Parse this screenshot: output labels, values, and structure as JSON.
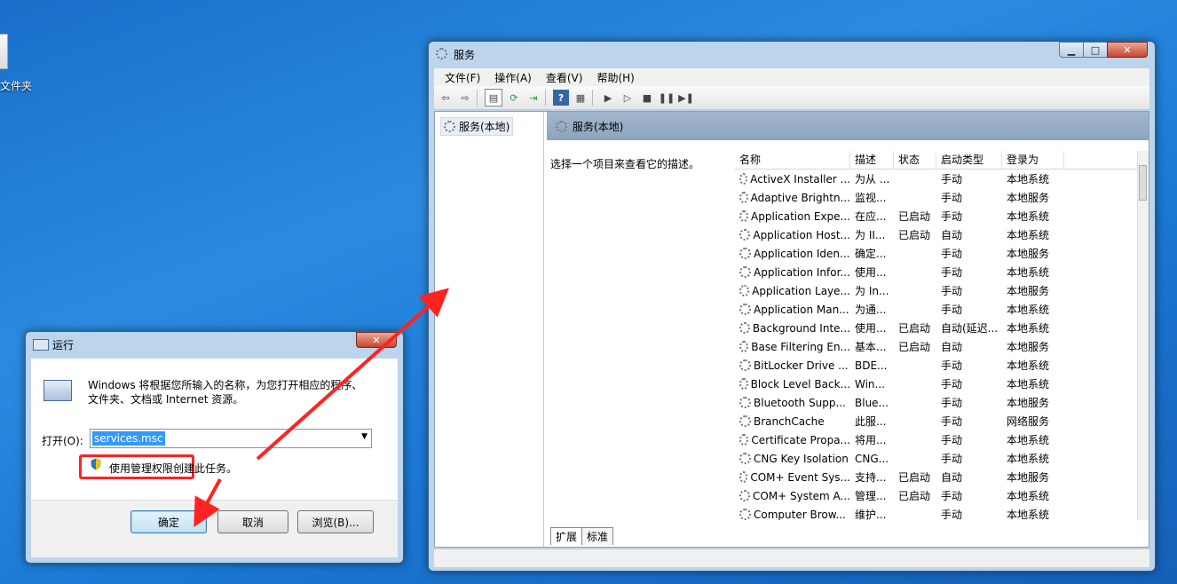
{
  "desktop": {
    "icon_label": "文件夹",
    "icon_name": "folder-icon"
  },
  "services_window": {
    "title": "服务",
    "controls": [
      "minimize",
      "maximize",
      "close"
    ],
    "menu": [
      "文件(F)",
      "操作(A)",
      "查看(V)",
      "帮助(H)"
    ],
    "toolbar_icons": [
      "back-icon",
      "forward-icon",
      "show-tree-icon",
      "refresh-icon",
      "export-icon",
      "help-icon",
      "properties-icon",
      "play-icon",
      "play-outline-icon",
      "stop-icon",
      "pause-icon",
      "restart-icon"
    ],
    "tree_item": "服务(本地)",
    "pane_title": "服务(本地)",
    "description_prompt": "选择一个项目来查看它的描述。",
    "columns": [
      "名称",
      "描述",
      "状态",
      "启动类型",
      "登录为"
    ],
    "rows": [
      [
        "ActiveX Installer ...",
        "为从 ...",
        "",
        "手动",
        "本地系统"
      ],
      [
        "Adaptive Brightn...",
        "监视...",
        "",
        "手动",
        "本地服务"
      ],
      [
        "Application Expe...",
        "在应...",
        "已启动",
        "手动",
        "本地系统"
      ],
      [
        "Application Host...",
        "为 II...",
        "已启动",
        "自动",
        "本地系统"
      ],
      [
        "Application Iden...",
        "确定...",
        "",
        "手动",
        "本地服务"
      ],
      [
        "Application Infor...",
        "使用...",
        "",
        "手动",
        "本地系统"
      ],
      [
        "Application Laye...",
        "为 In...",
        "",
        "手动",
        "本地服务"
      ],
      [
        "Application Man...",
        "为通...",
        "",
        "手动",
        "本地系统"
      ],
      [
        "Background Inte...",
        "使用...",
        "已启动",
        "自动(延迟...",
        "本地系统"
      ],
      [
        "Base Filtering En...",
        "基本...",
        "已启动",
        "自动",
        "本地服务"
      ],
      [
        "BitLocker Drive ...",
        "BDE...",
        "",
        "手动",
        "本地系统"
      ],
      [
        "Block Level Back...",
        "Win...",
        "",
        "手动",
        "本地系统"
      ],
      [
        "Bluetooth Supp...",
        "Blue...",
        "",
        "手动",
        "本地服务"
      ],
      [
        "BranchCache",
        "此服...",
        "",
        "手动",
        "网络服务"
      ],
      [
        "Certificate Propa...",
        "将用...",
        "",
        "手动",
        "本地系统"
      ],
      [
        "CNG Key Isolation",
        "CNG...",
        "",
        "手动",
        "本地系统"
      ],
      [
        "COM+ Event Sys...",
        "支持...",
        "已启动",
        "自动",
        "本地服务"
      ],
      [
        "COM+ System A...",
        "管理...",
        "已启动",
        "手动",
        "本地系统"
      ],
      [
        "Computer Brow...",
        "维护...",
        "",
        "手动",
        "本地系统"
      ]
    ],
    "tabs": [
      "扩展",
      "标准"
    ]
  },
  "run_dialog": {
    "title": "运行",
    "description": "Windows 将根据您所输入的名称，为您打开相应的程序、文件夹、文档或 Internet 资源。",
    "open_label": "打开(O):",
    "input_value": "services.msc",
    "admin_note": "使用管理权限创建此任务。",
    "ok_label": "确定",
    "cancel_label": "取消",
    "browse_label": "浏览(B)..."
  },
  "colors": {
    "annotation": "#ff2222",
    "selection": "#3399ff"
  }
}
